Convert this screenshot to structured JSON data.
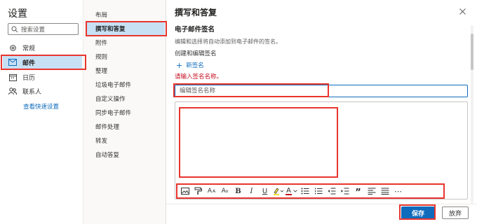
{
  "settings": {
    "title": "设置",
    "search": {
      "placeholder": "搜索设置",
      "icon": "search-icon"
    },
    "nav": [
      {
        "label": "常规",
        "icon": "gear-icon"
      },
      {
        "label": "邮件",
        "icon": "mail-icon",
        "active": true
      },
      {
        "label": "日历",
        "icon": "calendar-icon"
      },
      {
        "label": "联系人",
        "icon": "people-icon"
      }
    ],
    "quick_settings_link": "查看快速设置"
  },
  "mail_subnav": {
    "items": [
      {
        "label": "布局"
      },
      {
        "label": "撰写和答复",
        "active": true
      },
      {
        "label": "附件"
      },
      {
        "label": "规则"
      },
      {
        "label": "整理"
      },
      {
        "label": "垃圾电子邮件"
      },
      {
        "label": "自定义操作"
      },
      {
        "label": "同步电子邮件"
      },
      {
        "label": "邮件处理"
      },
      {
        "label": "转发"
      },
      {
        "label": "自动答复"
      }
    ]
  },
  "pane": {
    "title": "撰写和答复",
    "section_title": "电子邮件签名",
    "section_desc": "编辑和选择将自动添加到电子邮件的签名。",
    "subheading": "创建和编辑签名",
    "new_signature": "新签名",
    "error": "请输入签名名称。",
    "name_input": {
      "placeholder": "编辑签名名称",
      "value": ""
    },
    "toolbar": [
      {
        "name": "insert-picture-icon",
        "glyph": ""
      },
      {
        "name": "format-painter-icon",
        "glyph": ""
      },
      {
        "name": "font-size-icon",
        "glyph": "A"
      },
      {
        "name": "superscript-icon",
        "glyph": "A"
      },
      {
        "name": "bold-icon",
        "glyph": "B"
      },
      {
        "name": "italic-icon",
        "glyph": "I"
      },
      {
        "name": "underline-icon",
        "glyph": "U"
      },
      {
        "name": "highlight-icon",
        "glyph": ""
      },
      {
        "name": "font-color-icon",
        "glyph": "A"
      },
      {
        "name": "bullets-icon",
        "glyph": ""
      },
      {
        "name": "numbering-icon",
        "glyph": ""
      },
      {
        "name": "decrease-indent-icon",
        "glyph": ""
      },
      {
        "name": "increase-indent-icon",
        "glyph": ""
      },
      {
        "name": "quote-icon",
        "glyph": "”"
      },
      {
        "name": "align-left-icon",
        "glyph": ""
      },
      {
        "name": "align-justify-icon",
        "glyph": ""
      },
      {
        "name": "more-options-icon",
        "glyph": "⋯"
      }
    ],
    "buttons": {
      "save": "保存",
      "discard": "放弃"
    }
  },
  "colors": {
    "accent": "#0f6cbd",
    "selected_bg": "#c7e0f4",
    "error": "#c50f1f",
    "annotation": "#e8352e"
  }
}
